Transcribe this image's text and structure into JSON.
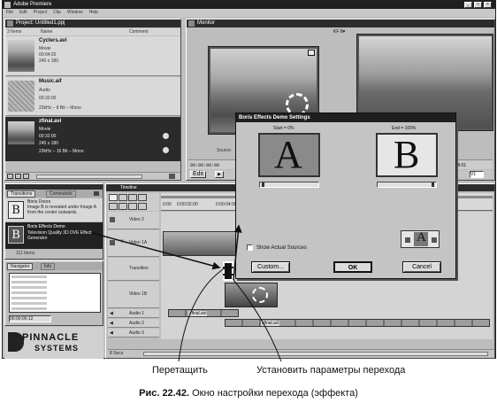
{
  "app": {
    "title": "Adobe Premiere",
    "window_buttons": [
      "_",
      "□",
      "×"
    ]
  },
  "menu": [
    "File",
    "Edit",
    "Project",
    "Clip",
    "Window",
    "Help"
  ],
  "project": {
    "title": "Project: Untitled1.ppj",
    "count": "3 Items",
    "columns": [
      "Name",
      "Comment"
    ],
    "items": [
      {
        "name": "Cyclers.avi",
        "lines": [
          "Movie",
          "00:04:20",
          "240 x 180"
        ]
      },
      {
        "name": "Music.aif",
        "lines": [
          "Audio",
          "00:32:00",
          "22kHz – 8 Bit – Mono"
        ]
      },
      {
        "name": "zfinal.avi",
        "lines": [
          "Movie",
          "00:32:00",
          "240 x 180",
          "22kHz – 16 Bit – Mono"
        ]
      }
    ]
  },
  "monitor": {
    "title": "Monitor",
    "badge": "KF 8♥",
    "source_label": "Source:",
    "source_value": "2",
    "tc_left": "00:00:00:00",
    "tc_right": "Δ 8:01",
    "target_label": "Target:",
    "target_value": "V1",
    "btns": [
      "Edit"
    ]
  },
  "transitions": {
    "tabs": [
      "Transitions",
      "Commands"
    ],
    "items": [
      {
        "title": "Boris Doors",
        "desc": "Image B is revealed under Image A from the center outwards."
      },
      {
        "title": "Boris Effects Demo",
        "desc": "Television Quality 3D DVE Effect Generator"
      }
    ],
    "count": "111 Items"
  },
  "navigator": {
    "tabs": [
      "Navigator",
      "Info"
    ],
    "timecode": "00:00:00:12"
  },
  "logo": {
    "line1": "PINNACLE",
    "line2": "SYSTEMS"
  },
  "timeline": {
    "title": "Timeline",
    "ruler": [
      "0:00",
      "0:00:02:00",
      "0:00:04:00"
    ],
    "tracks": [
      {
        "label": "Video 2"
      },
      {
        "label": "Video 1A"
      },
      {
        "label": "Transition"
      },
      {
        "label": "Video 1B"
      },
      {
        "label": "Audio 1"
      },
      {
        "label": "Audio 2"
      },
      {
        "label": "Audio 3"
      }
    ],
    "clips": {
      "audio1_a": "zfinal.avi",
      "audio2": "zfinal.avi"
    },
    "footer": "8 Secs"
  },
  "dialog": {
    "title": "Boris Effects Demo Settings",
    "start_label": "Start = 0%",
    "end_label": "End = 100%",
    "letter_a": "A",
    "letter_b": "B",
    "show_sources": "Show Actual Sources",
    "custom_btn": "Custom...",
    "ok_btn": "OK",
    "cancel_btn": "Cancel",
    "preview_letter": "A"
  },
  "annotations": {
    "drag": "Перетащить",
    "set_params": "Установить параметры перехода"
  },
  "caption": {
    "prefix": "Рис. 22.42.",
    "text": " Окно настройки перехода (эффекта)"
  }
}
